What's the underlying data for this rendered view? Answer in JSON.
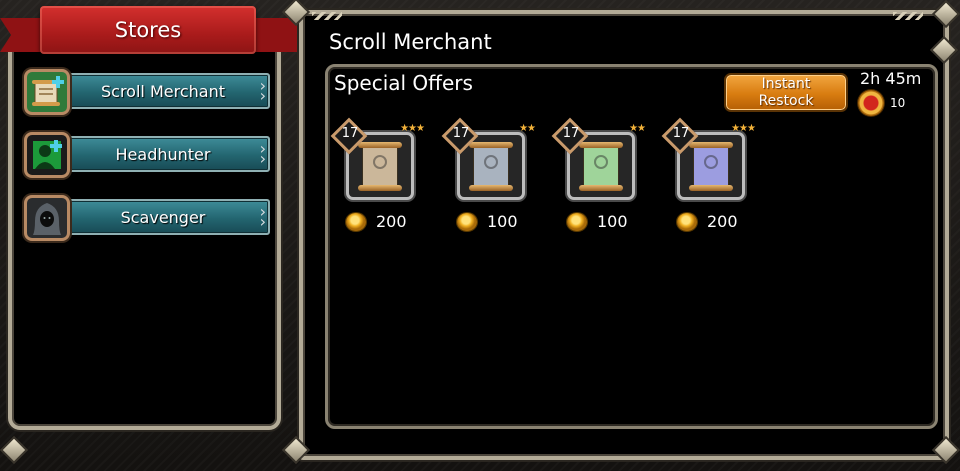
{
  "sidebar": {
    "title": "Stores",
    "items": [
      {
        "label": "Scroll Merchant",
        "icon": "scroll-merchant-icon"
      },
      {
        "label": "Headhunter",
        "icon": "headhunter-icon"
      },
      {
        "label": "Scavenger",
        "icon": "scavenger-icon"
      }
    ]
  },
  "main": {
    "title": "Scroll Merchant",
    "section_title": "Special Offers",
    "restock": {
      "label": "Instant\nRestock",
      "timer": "2h 45m",
      "cost": "10",
      "currency_icon": "gem-icon"
    },
    "offers": [
      {
        "level": "17",
        "stars": "★★★",
        "price": "200",
        "scroll_color": "#cbb79a",
        "icon": "scroll-icon",
        "currency_icon": "gold-coin-icon"
      },
      {
        "level": "17",
        "stars": "★★",
        "price": "100",
        "scroll_color": "#a9b3bf",
        "icon": "scroll-icon",
        "currency_icon": "gold-coin-icon"
      },
      {
        "level": "17",
        "stars": "★★",
        "price": "100",
        "scroll_color": "#9fd49a",
        "icon": "scroll-icon",
        "currency_icon": "gold-coin-icon"
      },
      {
        "level": "17",
        "stars": "★★★",
        "price": "200",
        "scroll_color": "#9c9de0",
        "icon": "scroll-icon",
        "currency_icon": "gold-coin-icon"
      }
    ]
  },
  "colors": {
    "ribbon": "#c42626",
    "store_button": "#2a6f7a",
    "restock_button": "#e08a1c",
    "frame": "#b3ab97",
    "star": "#f2b23a"
  }
}
